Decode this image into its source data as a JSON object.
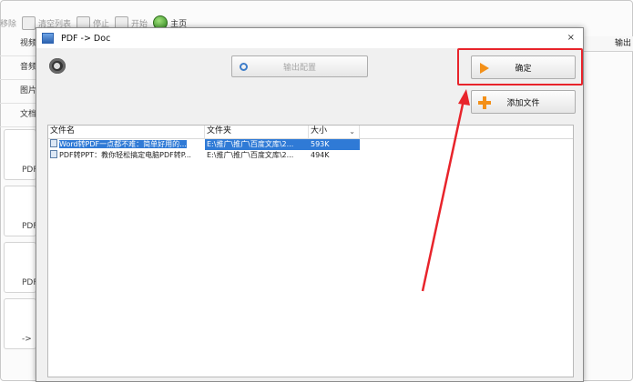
{
  "background": {
    "toolbar": {
      "remove_label": "移除",
      "clear_label": "清空列表",
      "stop_label": "停止",
      "start_label": "开始",
      "home_label": "主页"
    },
    "side_tabs": [
      "视频",
      "音频",
      "图片",
      "文档"
    ],
    "cards": [
      "PDF",
      "PDF",
      "PDF",
      "-> "
    ],
    "right_header": "输出"
  },
  "dialog": {
    "title": "PDF -> Doc",
    "close_symbol": "×",
    "output_config_label": "输出配置",
    "ok_label": "确定",
    "add_file_label": "添加文件",
    "table": {
      "headers": {
        "name": "文件名",
        "folder": "文件夹",
        "size": "大小"
      },
      "rows": [
        {
          "name": "Word转PDF一点都不难：简单好用的...",
          "folder": "E:\\推广\\推广\\百度文库\\2...",
          "size": "593K",
          "selected": true
        },
        {
          "name": "PDF转PPT：教你轻松搞定电脑PDF转P...",
          "folder": "E:\\推广\\推广\\百度文库\\2...",
          "size": "494K",
          "selected": false
        }
      ]
    }
  },
  "colors": {
    "accent_orange": "#f39019",
    "highlight_red": "#e8242b",
    "selection_blue": "#2f7ad6"
  }
}
